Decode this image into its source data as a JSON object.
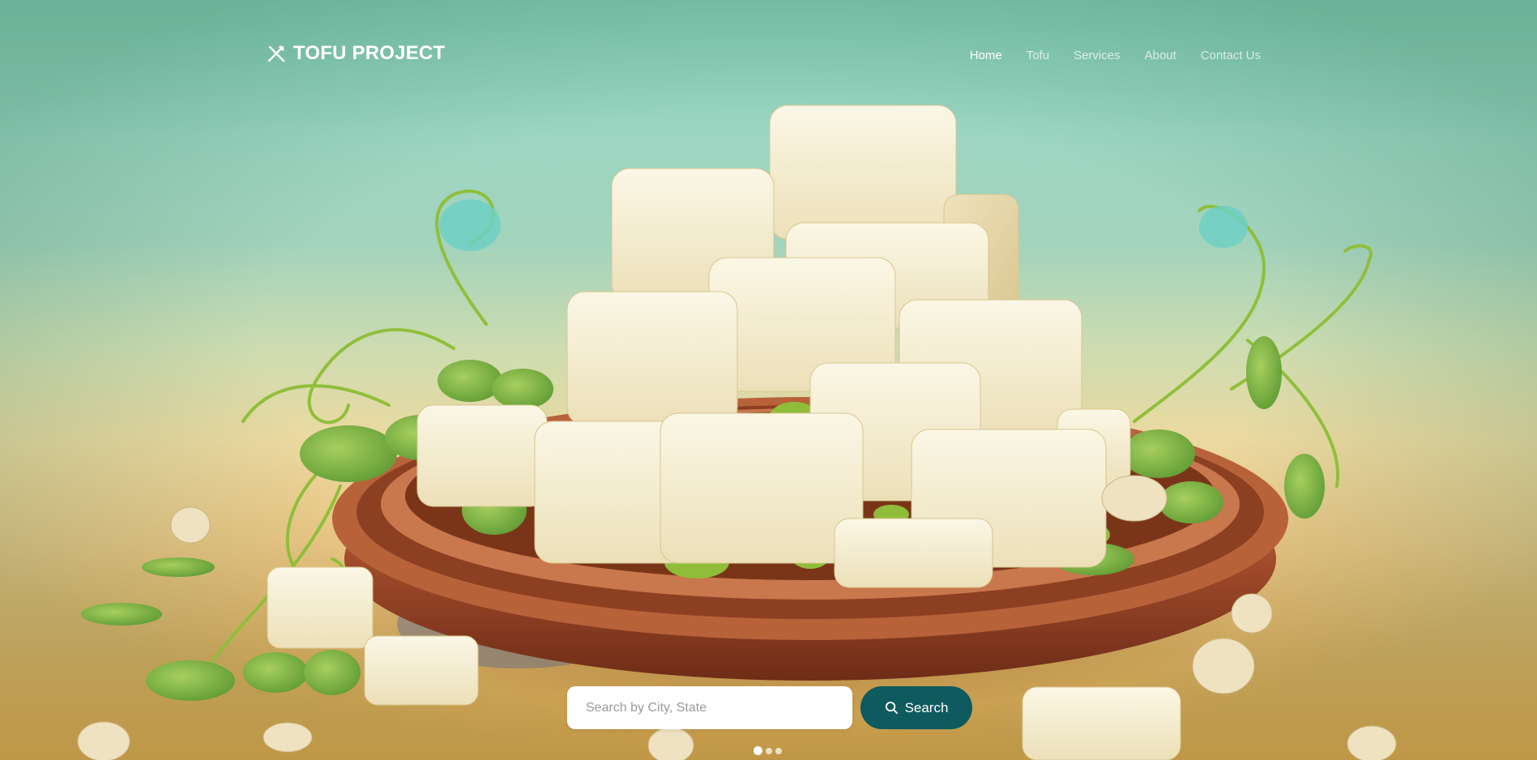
{
  "header": {
    "logo": {
      "text": "TOFU PROJECT",
      "icon": "utensils-icon"
    },
    "nav": [
      {
        "label": "Home",
        "active": true
      },
      {
        "label": "Tofu",
        "active": false
      },
      {
        "label": "Services",
        "active": false
      },
      {
        "label": "About",
        "active": false
      },
      {
        "label": "Contact Us",
        "active": false
      }
    ]
  },
  "hero": {
    "image": "tofu-plate-illustration"
  },
  "search": {
    "placeholder": "Search by City, State",
    "value": "",
    "button_label": "Search",
    "button_icon": "search-icon"
  },
  "carousel": {
    "slides": 3,
    "active_index": 0
  },
  "colors": {
    "accent": "#0d5b5f",
    "nav_active": "#ffffff",
    "nav_inactive": "rgba(255,255,255,0.72)"
  }
}
